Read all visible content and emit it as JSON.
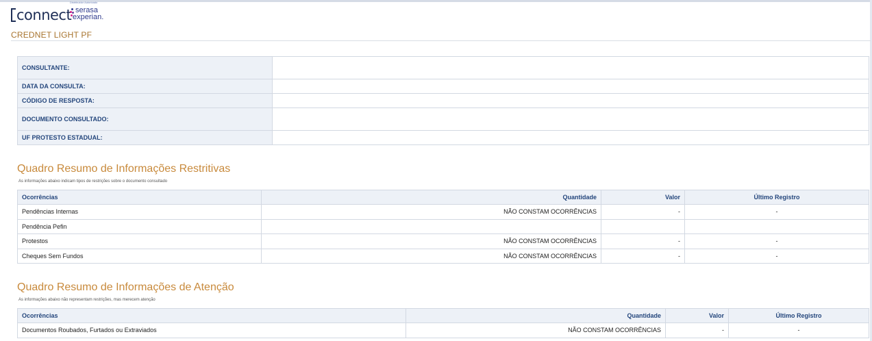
{
  "header": {
    "connect_logo_text": "connect",
    "serasa_top_text": "Distribuidor Autorizado",
    "serasa_line1": "serasa",
    "serasa_line2": "experian."
  },
  "page_title": "CREDNET LIGHT PF",
  "info_rows": [
    {
      "label": "CONSULTANTE:",
      "value": ""
    },
    {
      "label": "DATA DA CONSULTA:",
      "value": ""
    },
    {
      "label": "CÓDIGO DE RESPOSTA:",
      "value": ""
    },
    {
      "label": "DOCUMENTO CONSULTADO:",
      "value": ""
    },
    {
      "label": "UF PROTESTO ESTADUAL:",
      "value": ""
    }
  ],
  "restritivas": {
    "title": "Quadro Resumo de Informações Restritivas",
    "subtitle": "As informações abaixo indicam tipos de restrições sobre o documento consultado",
    "columns": [
      "Ocorrências",
      "Quantidade",
      "Valor",
      "Último Registro"
    ],
    "rows": [
      [
        "Pendências Internas",
        "NÃO CONSTAM OCORRÊNCIAS",
        "-",
        "-"
      ],
      [
        "Pendência Pefin",
        "",
        "",
        ""
      ],
      [
        "Protestos",
        "NÃO CONSTAM OCORRÊNCIAS",
        "-",
        "-"
      ],
      [
        "Cheques Sem Fundos",
        "NÃO CONSTAM OCORRÊNCIAS",
        "-",
        "-"
      ]
    ]
  },
  "atencao": {
    "title": "Quadro Resumo de Informações de Atenção",
    "subtitle": "As informações abaixo não representam restrições, mas merecem atenção",
    "columns": [
      "Ocorrências",
      "Quantidade",
      "Valor",
      "Último Registro"
    ],
    "rows": [
      [
        "Documentos Roubados, Furtados ou Extraviados",
        "NÃO CONSTAM OCORRÊNCIAS",
        "-",
        "-"
      ]
    ]
  },
  "colors": {
    "title_gold": "#a8742e",
    "section_orange": "#c88a3c",
    "label_blue": "#24467c",
    "label_bg": "#edf1f7",
    "serasa_pink": "#d4268b",
    "serasa_blue": "#2e3a8c"
  }
}
